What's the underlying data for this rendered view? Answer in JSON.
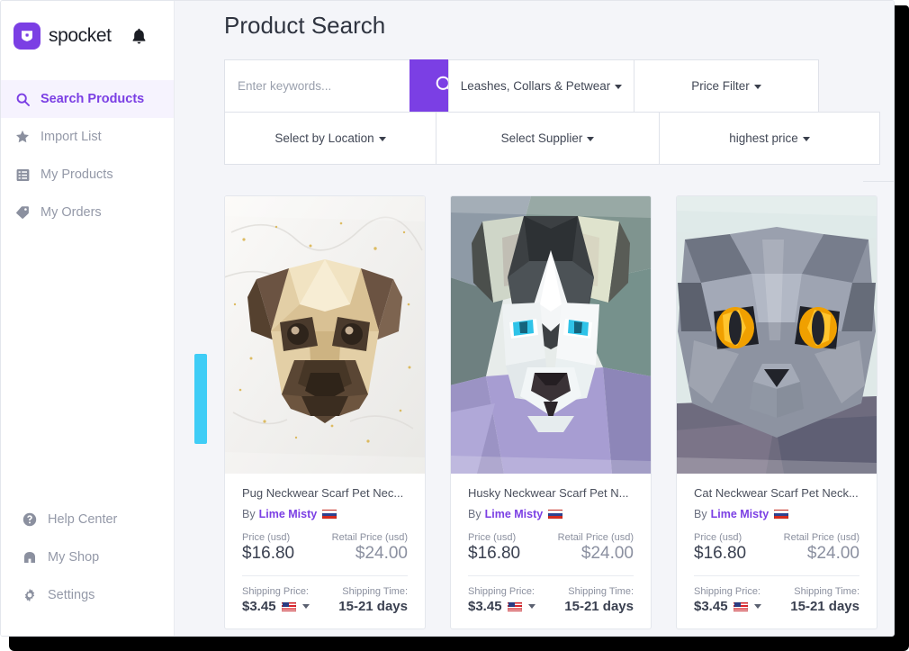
{
  "brand": {
    "name": "spocket",
    "logo_color": "#7B3FE4",
    "logo_icon": "spocket-shield-logo"
  },
  "topbar": {
    "bell_icon": "notification-bell-icon"
  },
  "sidebar": {
    "items": [
      {
        "label": "Search Products",
        "icon": "search-icon",
        "active": true
      },
      {
        "label": "Import List",
        "icon": "star-icon",
        "active": false
      },
      {
        "label": "My Products",
        "icon": "list-icon",
        "active": false
      },
      {
        "label": "My Orders",
        "icon": "tag-icon",
        "active": false
      }
    ],
    "bottom_items": [
      {
        "label": "Help Center",
        "icon": "question-circle-icon"
      },
      {
        "label": "My Shop",
        "icon": "shop-icon"
      },
      {
        "label": "Settings",
        "icon": "gear-icon"
      }
    ]
  },
  "main": {
    "title": "Product Search",
    "search": {
      "placeholder": "Enter keywords...",
      "value": "",
      "button_icon": "search-icon",
      "button_color": "#7B3FE4"
    },
    "filters": [
      {
        "label": "Leashes, Collars & Petwear",
        "name": "category-filter"
      },
      {
        "label": "Price Filter",
        "name": "price-filter"
      },
      {
        "label": "Select by Location",
        "name": "location-filter"
      },
      {
        "label": "Select Supplier",
        "name": "supplier-filter"
      },
      {
        "label": "highest price",
        "name": "sort-filter"
      }
    ],
    "scrollbar": {
      "color": "#3FCDF6"
    }
  },
  "products": [
    {
      "title": "Pug Neckwear Scarf Pet Nec...",
      "by_label": "By",
      "supplier": "Lime Misty",
      "supplier_flag": "russia-flag-icon",
      "price_label": "Price (usd)",
      "price": "$16.80",
      "retail_label": "Retail Price (usd)",
      "retail": "$24.00",
      "shipping_price_label": "Shipping Price:",
      "shipping_price": "$3.45",
      "shipping_flag": "usa-flag-icon",
      "shipping_time_label": "Shipping Time:",
      "shipping_time": "15-21 days",
      "image": "pug-lowpoly-scarf-image"
    },
    {
      "title": "Husky Neckwear Scarf Pet N...",
      "by_label": "By",
      "supplier": "Lime Misty",
      "supplier_flag": "russia-flag-icon",
      "price_label": "Price (usd)",
      "price": "$16.80",
      "retail_label": "Retail Price (usd)",
      "retail": "$24.00",
      "shipping_price_label": "Shipping Price:",
      "shipping_price": "$3.45",
      "shipping_flag": "usa-flag-icon",
      "shipping_time_label": "Shipping Time:",
      "shipping_time": "15-21 days",
      "image": "husky-lowpoly-scarf-image"
    },
    {
      "title": "Cat Neckwear Scarf Pet Neck...",
      "by_label": "By",
      "supplier": "Lime Misty",
      "supplier_flag": "russia-flag-icon",
      "price_label": "Price (usd)",
      "price": "$16.80",
      "retail_label": "Retail Price (usd)",
      "retail": "$24.00",
      "shipping_price_label": "Shipping Price:",
      "shipping_price": "$3.45",
      "shipping_flag": "usa-flag-icon",
      "shipping_time_label": "Shipping Time:",
      "shipping_time": "15-21 days",
      "image": "cat-lowpoly-scarf-image"
    }
  ]
}
